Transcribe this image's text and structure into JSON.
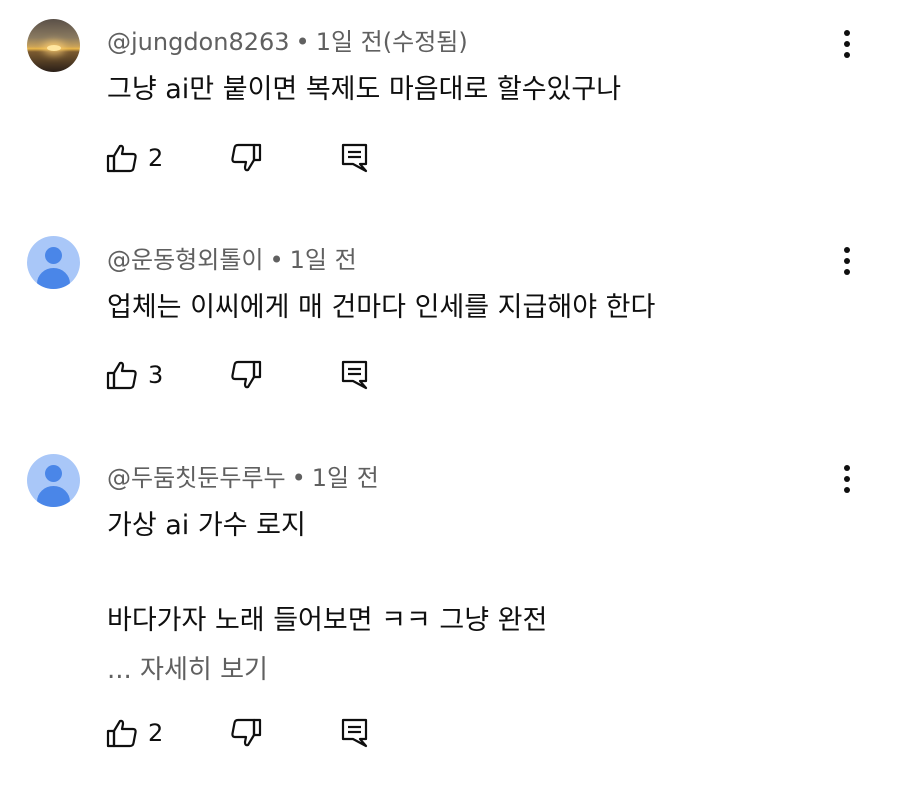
{
  "comments": [
    {
      "handle": "@jungdon8263",
      "separator": "•",
      "time": "1일 전(수정됨)",
      "avatar": "sunset-photo",
      "lines": [
        "그냥 ai만 붙이면 복제도 마음대로 할수있구나"
      ],
      "likes": "2"
    },
    {
      "handle": "@운동형외톨이",
      "separator": "•",
      "time": "1일 전",
      "avatar": "default-person",
      "lines": [
        "업체는 이씨에게 매 건마다 인세를 지급해야 한다"
      ],
      "likes": "3"
    },
    {
      "handle": "@두둠칫둔두루누",
      "separator": "•",
      "time": "1일 전",
      "avatar": "default-person",
      "lines": [
        "가상 ai 가수 로지",
        "바다가자 노래 들어보면 ㅋㅋ 그냥 완전"
      ],
      "read_more": "... 자세히 보기",
      "likes": "2"
    }
  ],
  "icons": {
    "like": "thumbs-up-icon",
    "dislike": "thumbs-down-icon",
    "reply": "reply-comment-icon",
    "menu": "more-vertical-icon"
  },
  "colors": {
    "text": "#0f0f0f",
    "meta": "#606060",
    "avatar_default_bg": "#a9c7f8",
    "avatar_default_fg": "#4a86e8"
  }
}
